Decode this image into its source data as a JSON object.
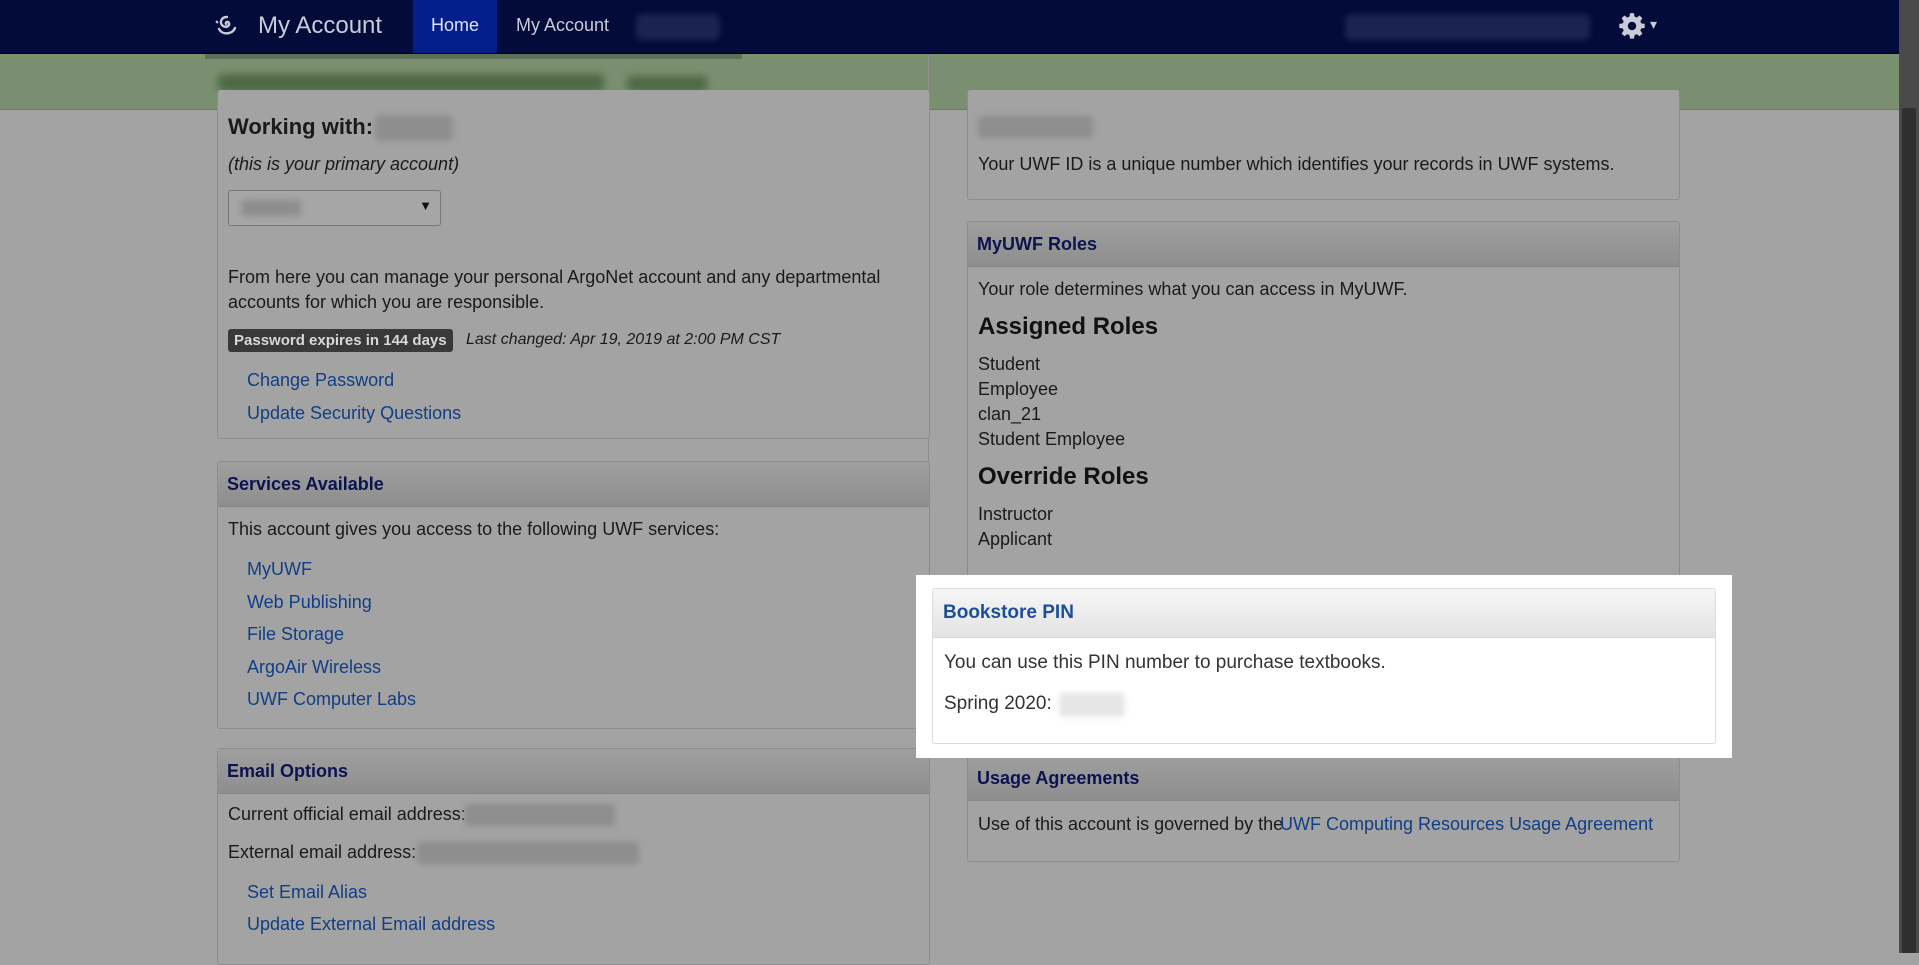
{
  "nav": {
    "brand": "My Account",
    "home_label": "Home",
    "account_label": "My Account",
    "settings_caret": "▾"
  },
  "left": {
    "working_with_label": "Working with:",
    "primary_note": "(this is your primary account)",
    "select_arrow": "▼",
    "intro_line1": "From here you can manage your personal ArgoNet account and any departmental",
    "intro_line2": "accounts for which you are responsible.",
    "password_badge": "Password expires in 144 days",
    "last_changed": "Last changed: Apr 19, 2019 at 2:00 PM CST",
    "change_password": "Change Password",
    "update_security": "Update Security Questions",
    "services": {
      "title": "Services Available",
      "intro": "This account gives you access to the following UWF services:",
      "items": [
        "MyUWF",
        "Web Publishing",
        "File Storage",
        "ArgoAir Wireless",
        "UWF Computer Labs"
      ]
    },
    "email": {
      "title": "Email Options",
      "official_label": "Current official email address:",
      "external_label": "External email address:",
      "set_alias": "Set Email Alias",
      "update_external": "Update External Email address"
    }
  },
  "right": {
    "uwf_id_desc": "Your UWF ID is a unique number which identifies your records in UWF systems.",
    "roles": {
      "title": "MyUWF Roles",
      "intro": "Your role determines what you can access in MyUWF.",
      "assigned_title": "Assigned Roles",
      "assigned": [
        "Student",
        "Employee",
        "clan_21",
        "Student Employee"
      ],
      "override_title": "Override Roles",
      "override": [
        "Instructor",
        "Applicant"
      ]
    },
    "bookstore": {
      "title": "Bookstore PIN",
      "desc": "You can use this PIN number to purchase textbooks.",
      "term_label": "Spring 2020:"
    },
    "usage": {
      "title": "Usage Agreements",
      "text": "Use of this account is governed by the",
      "link": "UWF Computing Resources Usage Agreement"
    }
  }
}
